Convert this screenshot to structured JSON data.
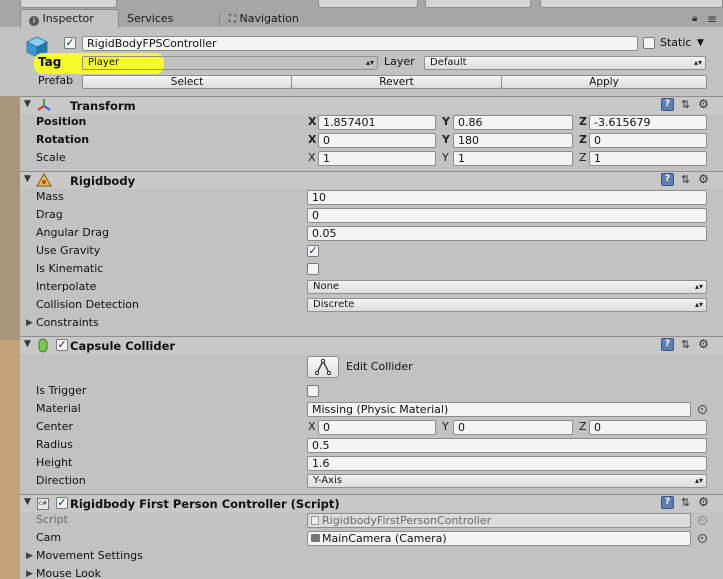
{
  "tabs": [
    {
      "label": "Inspector",
      "icon": "info-icon"
    },
    {
      "label": "Services"
    },
    {
      "label": "Navigation",
      "icon": "navigation-icon"
    }
  ],
  "object": {
    "name": "RigidBodyFPSController",
    "static_label": "Static",
    "tag_label": "Tag",
    "tag_value": "Player",
    "layer_label": "Layer",
    "layer_value": "Default",
    "prefab_label": "Prefab",
    "prefab_buttons": [
      "Select",
      "Revert",
      "Apply"
    ]
  },
  "transform": {
    "title": "Transform",
    "rows": [
      {
        "label": "Position",
        "x": "1.857401",
        "y": "0.86",
        "z": "-3.615679"
      },
      {
        "label": "Rotation",
        "x": "0",
        "y": "180",
        "z": "0"
      },
      {
        "label": "Scale",
        "x": "1",
        "y": "1",
        "z": "1"
      }
    ]
  },
  "rigidbody": {
    "title": "Rigidbody",
    "mass_label": "Mass",
    "mass": "10",
    "drag_label": "Drag",
    "drag": "0",
    "angular_drag_label": "Angular Drag",
    "angular_drag": "0.05",
    "use_gravity_label": "Use Gravity",
    "is_kinematic_label": "Is Kinematic",
    "interpolate_label": "Interpolate",
    "interpolate": "None",
    "collision_label": "Collision Detection",
    "collision": "Discrete",
    "constraints_label": "Constraints"
  },
  "capsule": {
    "title": "Capsule Collider",
    "edit_label": "Edit Collider",
    "is_trigger_label": "Is Trigger",
    "material_label": "Material",
    "material": "Missing (Physic Material)",
    "center_label": "Center",
    "cx": "0",
    "cy": "0",
    "cz": "0",
    "radius_label": "Radius",
    "radius": "0.5",
    "height_label": "Height",
    "height": "1.6",
    "direction_label": "Direction",
    "direction": "Y-Axis"
  },
  "script": {
    "title": "Rigidbody First Person Controller (Script)",
    "script_label": "Script",
    "script_value": "RigidbodyFirstPersonController",
    "cam_label": "Cam",
    "cam_value": "MainCamera (Camera)",
    "movement_label": "Movement Settings",
    "mouse_label": "Mouse Look"
  },
  "axis_labels": {
    "x": "X",
    "y": "Y",
    "z": "Z"
  },
  "colors": {
    "highlight": "#ffff1a",
    "panel": "#c2c2c2"
  }
}
